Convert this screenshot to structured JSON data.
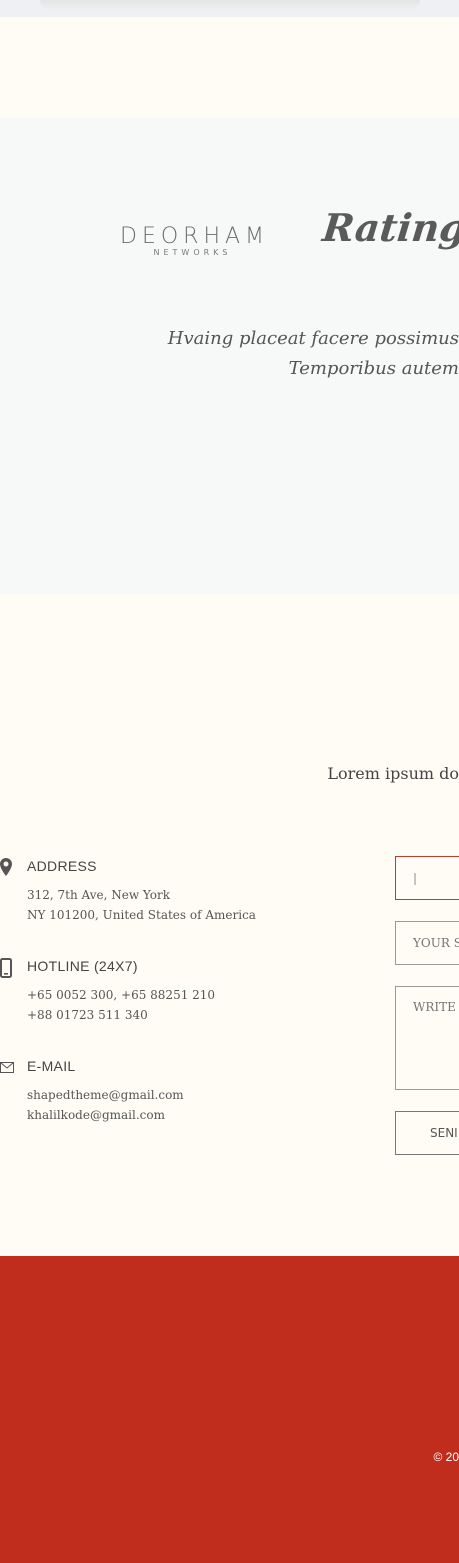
{
  "clients": {
    "logos": [
      {
        "name": "DEORHAM",
        "subtitle": "NETWORKS"
      },
      {
        "name": "Ratings"
      }
    ]
  },
  "testimonial": {
    "line1": "Hvaing placeat facere possimus",
    "line2": "Temporibus autem"
  },
  "contact": {
    "intro": "Lorem ipsum do",
    "address": {
      "icon": "map-marker-icon",
      "title": "ADDRESS",
      "lines": [
        "312, 7th Ave, New York",
        "NY 101200, United States of America"
      ]
    },
    "hotline": {
      "icon": "mobile-phone-icon",
      "title": "HOTLINE (24X7)",
      "lines": [
        "+65 0052 300, +65 88251 210",
        "+88 01723 511 340"
      ]
    },
    "email": {
      "icon": "envelope-icon",
      "title": "E-MAIL",
      "lines": [
        "shapedtheme@gmail.com",
        "khalilkode@gmail.com"
      ]
    },
    "form": {
      "name_value": "|",
      "subject_placeholder": "YOUR SU",
      "message_placeholder": "WRITE Y",
      "send_label": "SENI"
    }
  },
  "footer": {
    "copyright": "© 20"
  },
  "colors": {
    "footer_bg": "#c12d1d",
    "active_border": "#c43a2a",
    "cream_bg": "#fffcf5",
    "grey_bg": "#f7f8f8"
  }
}
